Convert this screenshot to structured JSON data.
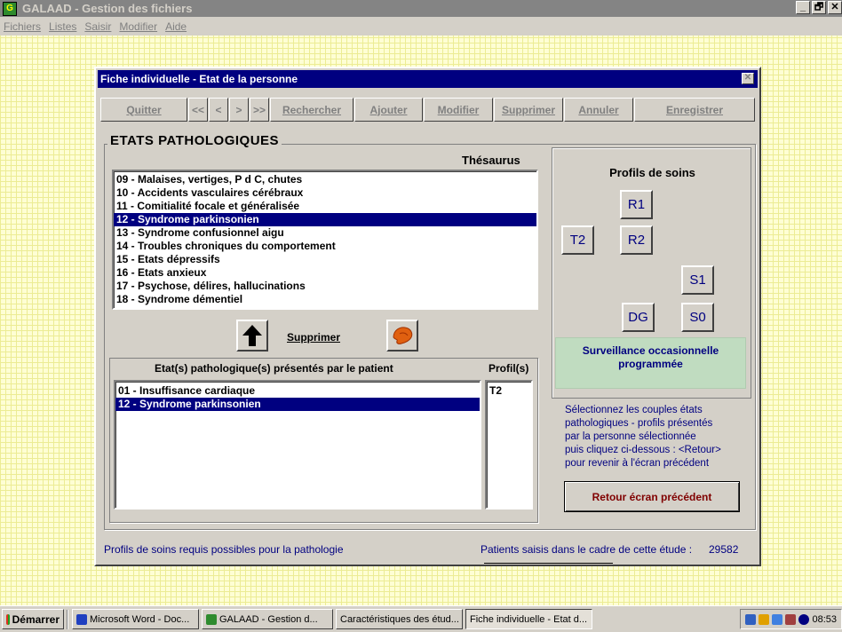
{
  "app": {
    "title": "GALAAD - Gestion des fichiers",
    "icon_label": "G"
  },
  "window_buttons": [
    "_",
    "🗗",
    "✕"
  ],
  "menu": [
    "Fichiers",
    "Listes",
    "Saisir",
    "Modifier",
    "Aide"
  ],
  "dialog": {
    "title": "Fiche individuelle - Etat de la personne",
    "close_symbol": "✕",
    "toolbar": {
      "quitter": "Quitter",
      "first": "<<",
      "prev": "<",
      "next": ">",
      "last": ">>",
      "rechercher": "Rechercher",
      "ajouter": "Ajouter",
      "modifier": "Modifier",
      "supprimer": "Supprimer",
      "annuler": "Annuler",
      "enregistrer": "Enregistrer"
    },
    "section_title": "ETATS PATHOLOGIQUES",
    "thesaurus_label": "Thésaurus",
    "thesaurus_items": [
      "09 - Malaises, vertiges, P d C, chutes",
      "10 - Accidents vasculaires cérébraux",
      "11 - Comitialité focale et généralisée",
      "12 - Syndrome parkinsonien",
      "13 - Syndrome confusionnel aigu",
      "14 - Troubles chroniques du comportement",
      "15 - Etats dépressifs",
      "16 - Etats anxieux",
      "17 - Psychose, délires, hallucinations",
      "18 - Syndrome démentiel"
    ],
    "thesaurus_selected_index": 3,
    "supprimer_label": "Supprimer",
    "patient_header": "Etat(s) pathologique(s) présentés par le patient",
    "profils_header": "Profil(s)",
    "patient_items": [
      "01 - Insuffisance cardiaque",
      "12 - Syndrome parkinsonien"
    ],
    "patient_selected_index": 1,
    "profils_items": [
      "T2"
    ],
    "profils_box": {
      "title": "Profils de soins",
      "buttons": {
        "r1": "R1",
        "t2": "T2",
        "r2": "R2",
        "s1": "S1",
        "dg": "DG",
        "s0": "S0"
      }
    },
    "surveillance_text": "Surveillance occasionnelle programmée",
    "help_text": [
      "Sélectionnez les couples états",
      "pathologiques - profils  présentés",
      "par la personne sélectionnée",
      "puis cliquez ci-dessous : <Retour>",
      "pour revenir à l'écran précédent"
    ],
    "retour_label": "Retour écran précédent",
    "footer_left": "Profils de soins requis possibles pour la pathologie",
    "footer_right_label": "Patients saisis dans le cadre de cette étude :",
    "footer_right_value": "29582"
  },
  "taskbar": {
    "start": "Démarrer",
    "tasks": [
      "Microsoft Word - Doc...",
      "GALAAD - Gestion d...",
      "Caractéristiques des étud...",
      "Fiche individuelle - Etat d..."
    ],
    "clock": "08:53"
  },
  "colors": {
    "title_blue": "#000080",
    "selection": "#000080",
    "surveillance_bg": "#c0dcc0",
    "retour_text": "#800000",
    "desktop": "#fefed4"
  }
}
